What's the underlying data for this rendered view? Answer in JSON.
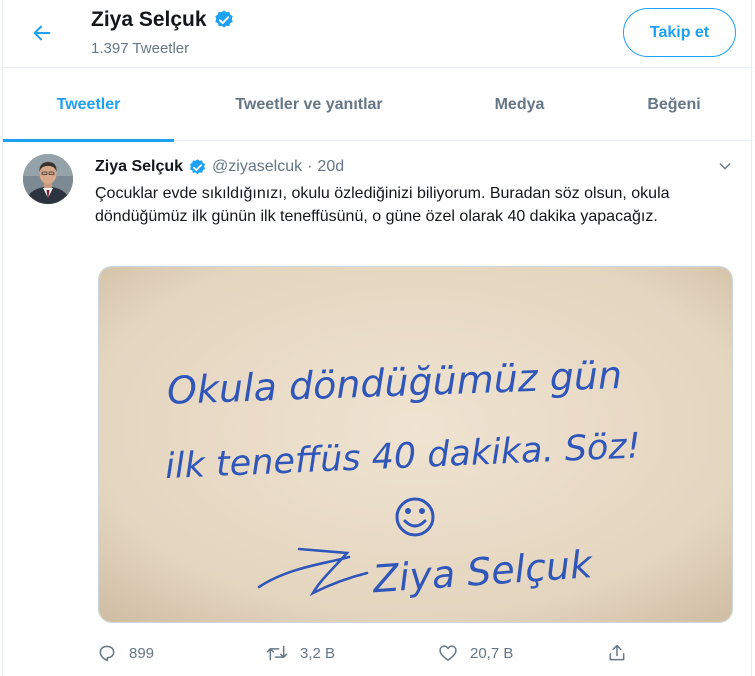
{
  "header": {
    "name": "Ziya Selçuk",
    "tweet_count": "1.397 Tweetler",
    "follow_label": "Takip et"
  },
  "tabs": [
    {
      "label": "Tweetler",
      "active": true
    },
    {
      "label": "Tweetler ve yanıtlar",
      "active": false
    },
    {
      "label": "Medya",
      "active": false
    },
    {
      "label": "Beğeni",
      "active": false
    }
  ],
  "tweet": {
    "name": "Ziya Selçuk",
    "handle": "@ziyaselcuk",
    "dot": "·",
    "time": "20d",
    "text": "Çocuklar evde sıkıldığınızı, okulu özlediğinizi biliyorum. Buradan söz olsun, okula döndüğümüz ilk günün ilk teneffüsünü, o güne özel olarak 40 dakika yapacağız.",
    "image_text": {
      "line1": "Okula döndüğümüz gün",
      "line2": "ilk teneffüs 40 dakika. Söz!",
      "signature": "Ziya Selçuk"
    },
    "actions": {
      "replies": "899",
      "retweets": "3,2 B",
      "likes": "20,7 B"
    }
  },
  "colors": {
    "accent": "#1da1f2",
    "muted": "#657786",
    "text": "#14171a",
    "divider": "#e6ecf0",
    "ink": "#2f56b8",
    "paper": "#e6d8c4"
  }
}
